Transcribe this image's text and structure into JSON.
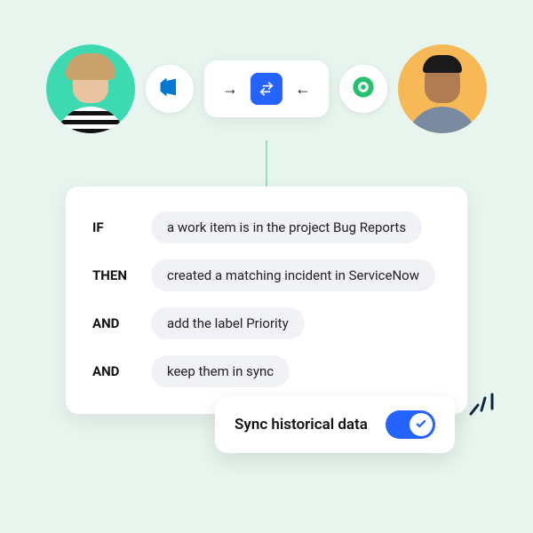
{
  "sync": {
    "left_arrow": "→",
    "right_arrow": "←"
  },
  "rules": [
    {
      "keyword": "IF",
      "text": "a work item is in the project Bug Reports"
    },
    {
      "keyword": "THEN",
      "text": "created a matching incident in ServiceNow"
    },
    {
      "keyword": "AND",
      "text": "add the label Priority"
    },
    {
      "keyword": "AND",
      "text": "keep them in sync"
    }
  ],
  "toggle": {
    "label": "Sync historical data",
    "on": true
  },
  "apps": {
    "left": "azure-devops",
    "right": "freshdesk"
  }
}
